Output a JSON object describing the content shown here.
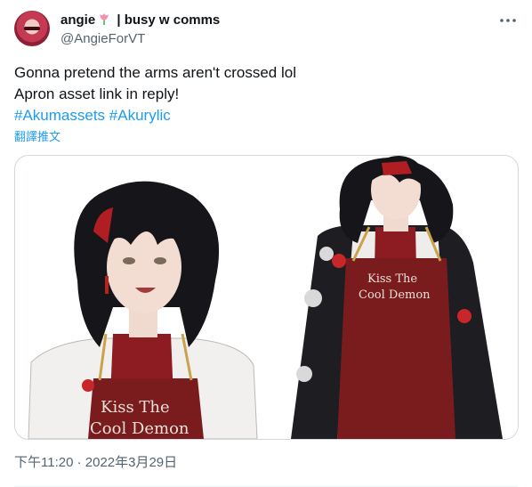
{
  "author": {
    "display_name": "angie",
    "display_name_suffix": "| busy w comms",
    "handle": "@AngieForVT",
    "avatar_icon": "avatar-image",
    "name_emoji_icon": "tulip-icon"
  },
  "tweet": {
    "lines": [
      "Gonna pretend the arms aren't crossed lol",
      "Apron asset link in reply!"
    ],
    "hashtags": [
      "#Akumassets",
      "#Akurylic"
    ],
    "translate_label": "翻譯推文",
    "timestamp": "下午11:20 · 2022年3月29日"
  },
  "media": {
    "left_apron_text_1": "Kiss The",
    "left_apron_text_2": "Cool Demon",
    "right_apron_text_1": "Kiss The",
    "right_apron_text_2": "Cool Demon"
  },
  "colors": {
    "link": "#1d9bf0",
    "secondary": "#536471",
    "apron": "#7a1c1e",
    "hair": "#15151a",
    "accent_red": "#c8262b"
  }
}
